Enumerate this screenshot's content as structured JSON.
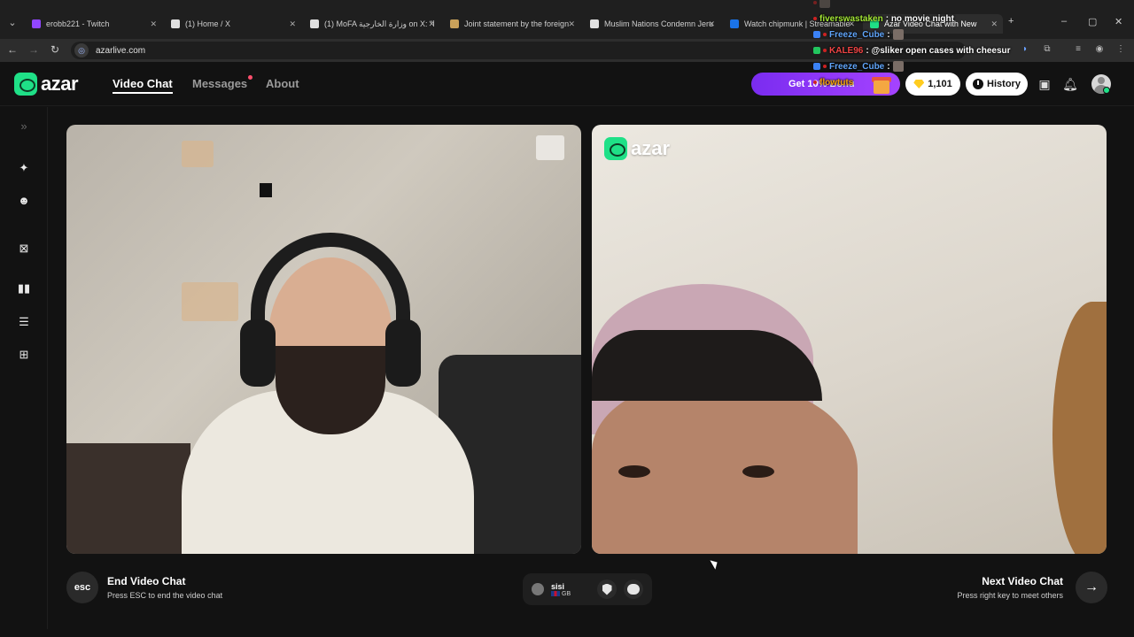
{
  "browser": {
    "tabs": [
      {
        "title": "erobb221 - Twitch",
        "color": "#9146ff"
      },
      {
        "title": "(1) Home / X",
        "color": "#e0e0e0"
      },
      {
        "title": "(1) MoFA وزارة الخارجية on X: \"ا",
        "color": "#e0e0e0"
      },
      {
        "title": "Joint statement by the foreign",
        "color": "#c9a15a"
      },
      {
        "title": "Muslim Nations Condemn Jeru",
        "color": "#e0e0e0"
      },
      {
        "title": "Watch chipmunk | Streamable",
        "color": "#1a73e8"
      },
      {
        "title": "Azar Video Chat with New",
        "color": "#1fe087"
      }
    ],
    "url": "azarlive.com"
  },
  "chat_overlay": [
    {
      "user": "fiverswastaken",
      "message": ": no movie night",
      "user_color": "#a3e635"
    },
    {
      "user": "Freeze_Cube",
      "message": ":",
      "user_color": "#60a5fa"
    },
    {
      "user": "KALE96",
      "message": ": @sliker open cases with cheesur",
      "user_color": "#ef4444",
      "mention": "@sliker"
    },
    {
      "user": "Freeze_Cube",
      "message": ":",
      "user_color": "#60a5fa"
    },
    {
      "user": "flowtuts",
      "message": "",
      "user_color": "#f59e0b"
    }
  ],
  "header": {
    "brand": "azar",
    "nav": [
      "Video Chat",
      "Messages",
      "About"
    ],
    "bonus_label": "Get 10% Bonu",
    "gems": "1,101",
    "history_label": "History"
  },
  "video": {
    "watermark": "azar"
  },
  "controls": {
    "esc_key": "esc",
    "end_title": "End Video Chat",
    "end_sub": "Press ESC to end the video chat",
    "peer_name": "sisi",
    "peer_country": "GB",
    "next_title": "Next Video Chat",
    "next_sub": "Press right key to meet others",
    "next_arrow": "→"
  },
  "colors": {
    "accent": "#1fe087",
    "bonus_gradient_start": "#7a2cf0",
    "bonus_gradient_end": "#a543ff",
    "gem": "#ffcc1f"
  }
}
